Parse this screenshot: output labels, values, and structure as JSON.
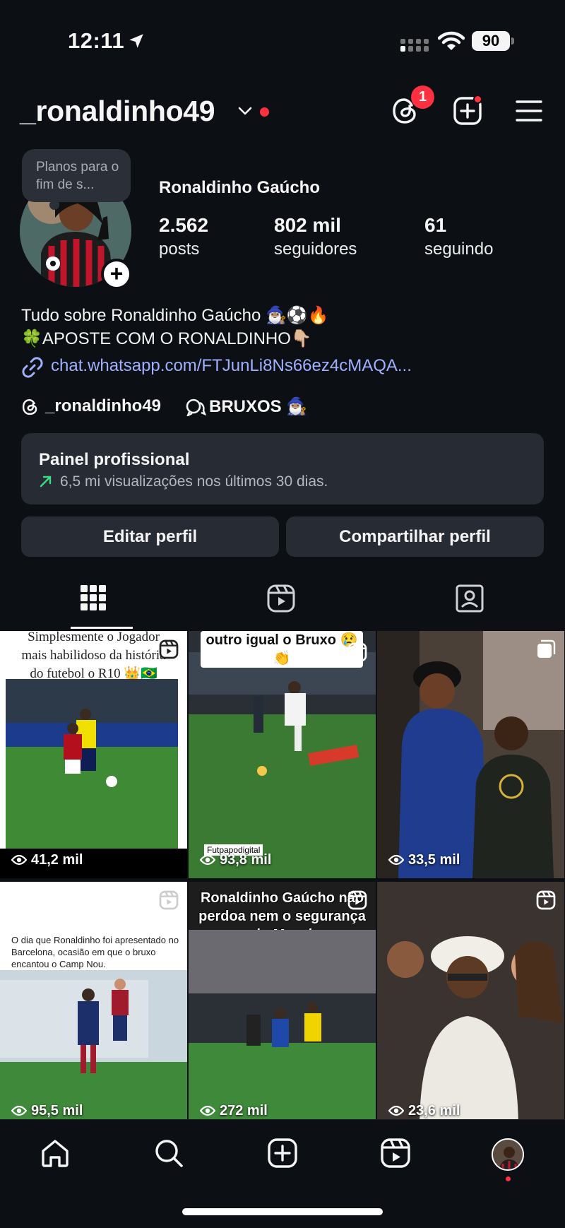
{
  "status_bar": {
    "time": "12:11",
    "battery": "90"
  },
  "header": {
    "username": "_ronaldinho49",
    "threads_badge": "1"
  },
  "profile": {
    "note": "Planos para o fim de s...",
    "full_name": "Ronaldinho Gaúcho",
    "stats": [
      {
        "value": "2.562",
        "label": "posts"
      },
      {
        "value": "802 mil",
        "label": "seguidores"
      },
      {
        "value": "61",
        "label": "seguindo"
      }
    ],
    "bio_line1": "Tudo sobre Ronaldinho Gaúcho 🧙🏽‍♂️⚽🔥",
    "bio_line2": "🍀APOSTE COM O RONALDINHO👇🏼",
    "link": "chat.whatsapp.com/FTJunLi8Ns66ez4cMAQA...",
    "threads_handle": "_ronaldinho49",
    "channel_name": "BRUXOS 🧙🏽‍♂️"
  },
  "dashboard": {
    "title": "Painel profissional",
    "subtitle": "6,5 mi visualizações nos últimos 30 dias."
  },
  "buttons": {
    "edit": "Editar perfil",
    "share": "Compartilhar perfil"
  },
  "posts": [
    {
      "views": "41,2 mil",
      "caption": "Simplesmente o Jogador mais habilidoso da história do futebol o R10 👑🇧🇷"
    },
    {
      "views": "93,8 mil",
      "caption": "outro igual o Bruxo 😢👏",
      "watermark": "Futpapodigital"
    },
    {
      "views": "33,5 mil"
    },
    {
      "views": "95,5 mil",
      "caption": "O dia que Ronaldinho foi apresentado no Barcelona, ocasião em que o bruxo encantou o Camp Nou."
    },
    {
      "views": "272 mil",
      "caption": "Ronaldinho Gaúcho não perdoa nem o segurança do Messi"
    },
    {
      "views": "23,6 mil"
    }
  ],
  "colors": {
    "background": "#0c0f14",
    "card": "#272b33",
    "notification": "#ff3040",
    "link": "#9fb0ff",
    "trend": "#3ddc84"
  }
}
